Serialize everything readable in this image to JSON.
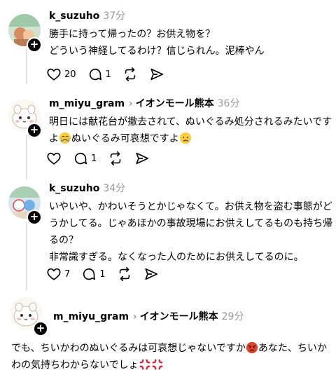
{
  "posts": [
    {
      "username": "k_suzuho",
      "location": "",
      "time": "37分",
      "lines": [
        "勝手に持って帰ったの？お供え物を？",
        "どういう神経してるわけ？信じられん。泥棒やん"
      ],
      "likes": "20",
      "replies": "1"
    },
    {
      "username": "m_miyu_gram",
      "separator": "›",
      "location": "イオンモール熊本",
      "time": "36分",
      "line1": "明日には献花台が撤去されて、ぬいぐるみ処分されるみたいです",
      "line2a": "よ",
      "line2b": "ぬいぐるみ可哀想ですよ",
      "likes": "",
      "replies": "1"
    },
    {
      "username": "k_suzuho",
      "location": "",
      "time": "34分",
      "lines": [
        "いやいや、かわいそうとかじゃなくて。お供え物を盗む事態がど",
        "うかしてる。じゃあほかの事故現場にお供えしてるものも持ち帰",
        "るの？",
        "非常識すぎる。なくなった人のためにお供えしてるのに。"
      ],
      "likes": "7",
      "replies": "1"
    },
    {
      "username": "m_miyu_gram",
      "separator": "›",
      "location": "イオンモール熊本",
      "time": "29分",
      "line1a": "でも、ちいかわのぬいぐるみは可哀想じゃないですか",
      "line1b": "あなた、ちいか",
      "line2": "わの気持ちわからないでしょ"
    }
  ],
  "icons": [
    "heart-icon",
    "comment-icon",
    "repost-icon",
    "share-icon",
    "plus-icon"
  ],
  "colors": {
    "accent_plus": "#000000",
    "time": "#9a9a9a",
    "thread_line": "#e1e1e1",
    "angry_emoji": "#e0452c",
    "anger_symbol": "#d8283a"
  }
}
